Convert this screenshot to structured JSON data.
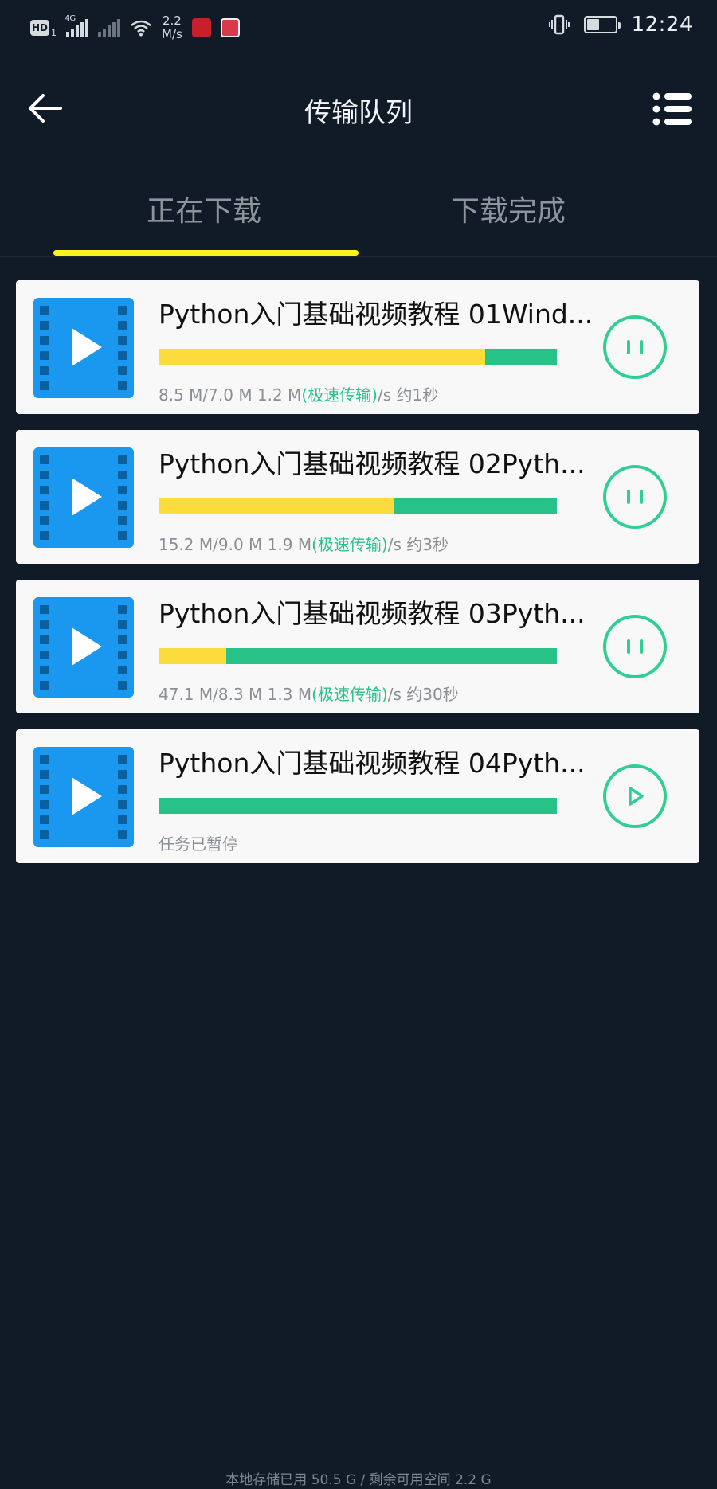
{
  "status_bar": {
    "hd_label": "HD",
    "sim_slot": "1",
    "network_label": "4G",
    "speed_value": "2.2",
    "speed_unit": "M/s",
    "time": "12:24",
    "battery_level_percent": 45
  },
  "header": {
    "title": "传输队列"
  },
  "tabs": [
    {
      "label": "正在下载",
      "active": true
    },
    {
      "label": "下载完成",
      "active": false
    }
  ],
  "tasks": [
    {
      "title": "Python入门基础视频教程 01Wind...",
      "progress_fraction": 0.82,
      "info_prefix": "8.5 M/7.0 M 1.2 M",
      "info_turbo": "(极速传输)",
      "info_suffix": "/s 约1秒",
      "state": "downloading",
      "action_icon": "pause-icon"
    },
    {
      "title": "Python入门基础视频教程 02Pyth...",
      "progress_fraction": 0.59,
      "info_prefix": "15.2 M/9.0 M 1.9 M",
      "info_turbo": "(极速传输)",
      "info_suffix": "/s 约3秒",
      "state": "downloading",
      "action_icon": "pause-icon"
    },
    {
      "title": "Python入门基础视频教程 03Pyth...",
      "progress_fraction": 0.17,
      "info_prefix": "47.1 M/8.3 M 1.3 M",
      "info_turbo": "(极速传输)",
      "info_suffix": "/s 约30秒",
      "state": "downloading",
      "action_icon": "pause-icon"
    },
    {
      "title": "Python入门基础视频教程 04Pyth...",
      "progress_fraction": 0,
      "info_prefix": "任务已暂停",
      "info_turbo": "",
      "info_suffix": "",
      "state": "paused",
      "action_icon": "play-icon"
    }
  ],
  "footer": {
    "storage_text": "本地存储已用 50.5 G / 剩余可用空间 2.2 G"
  },
  "colors": {
    "background": "#111a27",
    "accent_yellow": "#fcdc3c",
    "accent_green": "#27c287",
    "tab_indicator": "#fff31f",
    "thumbnail_blue": "#1a97ee"
  }
}
